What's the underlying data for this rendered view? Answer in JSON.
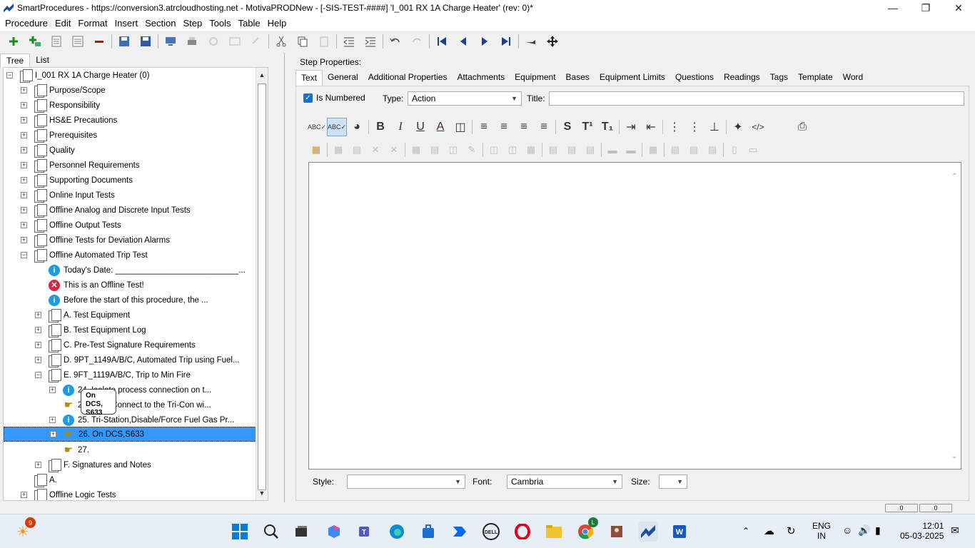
{
  "window": {
    "title": "SmartProcedures - https://conversion3.atrcloudhosting.net - MotivaPRODNew - [-SIS-TEST-####] 'I_001 RX 1A Charge Heater' (rev: 0)*"
  },
  "menu": [
    "Procedure",
    "Edit",
    "Format",
    "Insert",
    "Section",
    "Step",
    "Tools",
    "Table",
    "Help"
  ],
  "left_tabs": [
    "Tree",
    "List"
  ],
  "tree": {
    "root": "I_001 RX 1A Charge Heater (0)",
    "sections": [
      "Purpose/Scope",
      "Responsibility",
      "HS&E Precautions",
      "Prerequisites",
      "Quality",
      "Personnel Requirements",
      "Supporting Documents",
      "Online Input Tests",
      "Offline Analog and Discrete Input Tests",
      "Offline Output Tests",
      "Offline Tests for Deviation Alarms",
      "Offline Automated Trip Test"
    ],
    "trip_children": [
      "Today's Date: ___________________________...",
      "This is an Offline Test!",
      "Before the start of this procedure, the ...",
      "A. Test Equipment",
      "B. Test Equipment Log",
      "C. Pre-Test Signature Requirements",
      "D. 9PT_1149A/B/C, Automated Trip using Fuel...",
      "E. 9FT_1119A/B/C, Trip to Min Fire"
    ],
    "e_children": [
      "24. Isolate process connection on t...",
      "25. ation,Connect to the Tri-Con wi...",
      "25. Tri-Station,Disable/Force Fuel Gas Pr...",
      "26. On DCS,S633",
      "27."
    ],
    "after": [
      "F. Signatures and Notes",
      "A.",
      "Offline Logic Tests"
    ],
    "tooltip": "On DCS, S633"
  },
  "right": {
    "step_props_label": "Step Properties:",
    "tabs": [
      "Text",
      "General",
      "Additional Properties",
      "Attachments",
      "Equipment",
      "Bases",
      "Equipment Limits",
      "Questions",
      "Readings",
      "Tags",
      "Template",
      "Word"
    ],
    "is_numbered_label": "Is Numbered",
    "type_label": "Type:",
    "type_value": "Action",
    "title_label": "Title:",
    "style_label": "Style:",
    "font_label": "Font:",
    "font_value": "Cambria",
    "size_label": "Size:",
    "status_values": [
      "0",
      "0"
    ]
  },
  "taskbar": {
    "widget_badge": "9",
    "lang": "ENG",
    "region": "IN",
    "time": "12:01",
    "date": "05-03-2025",
    "chrome_badge": "L"
  }
}
